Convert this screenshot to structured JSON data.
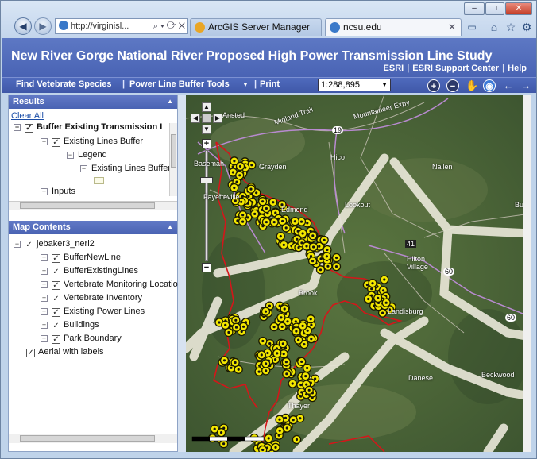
{
  "browser": {
    "address": "http://virginisl...",
    "tabs": [
      {
        "label": "ArcGIS Server Manager"
      },
      {
        "label": "ncsu.edu"
      }
    ],
    "window_buttons": [
      "–",
      "□",
      "✕"
    ]
  },
  "app": {
    "title": "New River Gorge National River Proposed High Power Transmission Line Study",
    "links": [
      "ESRI",
      "ESRI Support Center",
      "Help"
    ]
  },
  "toolbar": {
    "find_species": "Find Vetebrate Species",
    "buffer_tools": "Power Line Buffer Tools",
    "print": "Print",
    "scale": "1:288,895"
  },
  "results": {
    "header": "Results",
    "clear_all": "Clear All",
    "items": [
      {
        "label": "Buffer Existing Transmission I"
      },
      {
        "label": "Existing Lines Buffer"
      },
      {
        "label": "Legend"
      },
      {
        "label": "Existing Lines Buffer"
      },
      {
        "label": "Inputs"
      }
    ]
  },
  "map_contents": {
    "header": "Map Contents",
    "root": "jebaker3_neri2",
    "layers": [
      {
        "label": "BufferNewLine"
      },
      {
        "label": "BufferExistingLines"
      },
      {
        "label": "Vertebrate Monitoring Locatio"
      },
      {
        "label": "Vertebrate Inventory"
      },
      {
        "label": "Existing Power Lines"
      },
      {
        "label": "Buildings"
      },
      {
        "label": "Park Boundary"
      }
    ],
    "basemap": "Aerial with labels"
  },
  "map": {
    "labels": [
      {
        "text": "Ansted"
      },
      {
        "text": "Midland Trail"
      },
      {
        "text": "Mountaineer Expy"
      },
      {
        "text": "19"
      },
      {
        "text": "Hico"
      },
      {
        "text": "Grayden"
      },
      {
        "text": "Nallen"
      },
      {
        "text": "Edmond"
      },
      {
        "text": "Lookout"
      },
      {
        "text": "Burde"
      },
      {
        "text": "Fayetteville"
      },
      {
        "text": "41"
      },
      {
        "text": "Hilton Village"
      },
      {
        "text": "60"
      },
      {
        "text": "Brook"
      },
      {
        "text": "Landisburg"
      },
      {
        "text": "60"
      },
      {
        "text": "Danese"
      },
      {
        "text": "Beckwood"
      },
      {
        "text": "Thayer"
      },
      {
        "text": "Basemah"
      }
    ]
  },
  "colors": {
    "header_blue": "#4963b4",
    "buffer_yellow": "#f2e600",
    "boundary_red": "#d4161a"
  }
}
